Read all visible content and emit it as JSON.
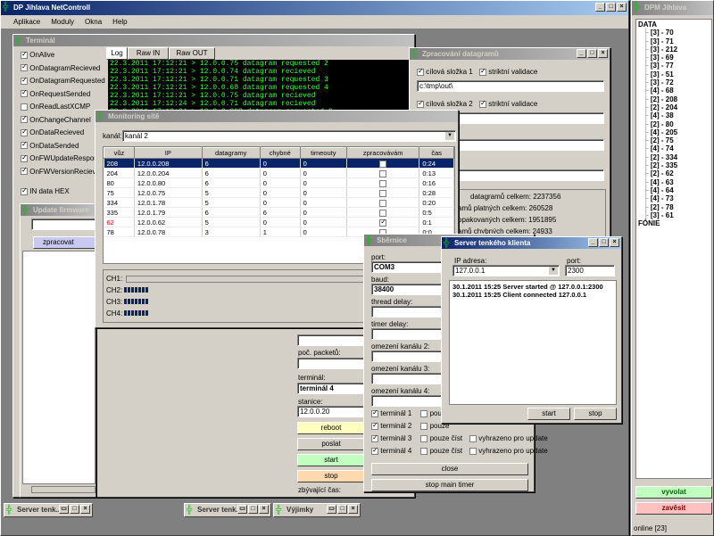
{
  "app": {
    "title": "DP Jihlava NetControll",
    "menu": [
      "Aplikace",
      "Moduly",
      "Okna",
      "Help"
    ]
  },
  "terminal": {
    "title": "Terminál",
    "checks": [
      {
        "label": "OnAlive",
        "on": true
      },
      {
        "label": "OnDatagramRecieved",
        "on": true
      },
      {
        "label": "OnDatagramRequested",
        "on": true
      },
      {
        "label": "OnRequestSended",
        "on": true
      },
      {
        "label": "OnReadLastXCMP",
        "on": false
      },
      {
        "label": "OnChangeChannel",
        "on": true
      },
      {
        "label": "OnDataRecieved",
        "on": true
      },
      {
        "label": "OnDataSended",
        "on": true
      },
      {
        "label": "OnFWUpdateResponse",
        "on": true
      },
      {
        "label": "OnFWVersionRecieved",
        "on": true
      }
    ],
    "in_data_hex": "IN data HEX",
    "tabs": [
      "Log",
      "Raw IN data",
      "Raw OUT data"
    ],
    "log": [
      "22.3.2011 17:12:21 > 12.0.0.75 datagram requested 2",
      "22.3.2011 17:12:21 > 12.0.0.74 datagram recieved",
      "22.3.2011 17:12:21 > 12.0.0.71 datagram requested 3",
      "22.3.2011 17:12:21 > 12.0.0.68 datagram requested 4",
      "22.3.2011 17:12:21 > 12.0.0.75 datagram recieved",
      "22.3.2011 17:12:24 > 12.0.0.71 datagram recieved",
      "22.3.2011 17:12:24 > 12.0.0.208 datagram requested 2",
      "22.3.2011 17:12:25 > 12.0.0.68 datagram recieved"
    ],
    "poc_packetu": "poč. packetů:",
    "terminal_label": "terminál:",
    "terminal_value": "terminál 4",
    "stanice_label": "stanice:",
    "stanice_value": "12.0.0.20",
    "reboot": "reboot",
    "poslat": "poslat",
    "start": "start",
    "stop": "stop",
    "zbyvajici": "zbývající čas:"
  },
  "update_fw": {
    "title": "Update firmware",
    "zpracovat": "zpracovat"
  },
  "zpracovani": {
    "title": "Zpracování datagramů",
    "cilova1": "cílová složka 1",
    "striktni1": "striktní validace",
    "path1": "c:\\tmp\\out\\",
    "cilova2": "cílová složka 2",
    "striktni2": "striktní validace",
    "stats": [
      "datagramů celkem: 2237356",
      "amů platných celkem: 260528",
      "opakovaných celkem: 1951895",
      "amů chybných celkem: 24933"
    ]
  },
  "monitoring": {
    "title": "Monitoring sítě",
    "kanal_label": "kanál:",
    "kanal_value": "kanál 2",
    "columns": [
      "vůz",
      "IP",
      "datagramy",
      "chybné",
      "timeouty",
      "zpracovávám",
      "čas"
    ],
    "rows": [
      {
        "vuz": "208",
        "ip": "12.0.0.208",
        "dg": "6",
        "ch": "0",
        "to": "0",
        "zp": false,
        "cas": "0:24",
        "sel": true
      },
      {
        "vuz": "204",
        "ip": "12.0.0.204",
        "dg": "6",
        "ch": "0",
        "to": "0",
        "zp": false,
        "cas": "0:13"
      },
      {
        "vuz": "80",
        "ip": "12.0.0.80",
        "dg": "6",
        "ch": "0",
        "to": "0",
        "zp": false,
        "cas": "0:16"
      },
      {
        "vuz": "75",
        "ip": "12.0.0.75",
        "dg": "5",
        "ch": "0",
        "to": "0",
        "zp": false,
        "cas": "0:28"
      },
      {
        "vuz": "334",
        "ip": "12.0.1.78",
        "dg": "5",
        "ch": "0",
        "to": "0",
        "zp": false,
        "cas": "0:20"
      },
      {
        "vuz": "335",
        "ip": "12.0.1.79",
        "dg": "6",
        "ch": "6",
        "to": "0",
        "zp": false,
        "cas": "0:5"
      },
      {
        "vuz": "62",
        "ip": "12.0.0.62",
        "dg": "5",
        "ch": "0",
        "to": "0",
        "zp": true,
        "cas": "0:1",
        "red": true
      },
      {
        "vuz": "78",
        "ip": "12.0.0.78",
        "dg": "3",
        "ch": "1",
        "to": "0",
        "zp": false,
        "cas": "0:0"
      }
    ],
    "channels": [
      {
        "name": "CH1:",
        "bars": 0
      },
      {
        "name": "CH2:",
        "bars": 7
      },
      {
        "name": "CH3:",
        "bars": 7
      },
      {
        "name": "CH4:",
        "bars": 7
      }
    ]
  },
  "sbernice": {
    "title": "Sběrnice",
    "port_label": "port:",
    "port_value": "COM3",
    "baud_label": "baud:",
    "baud_value": "38400",
    "thread_delay": "thread delay:",
    "timer_delay": "timer delay:",
    "omez2": "omezení kanálu 2:",
    "omez3": "omezení kanálu 3:",
    "omez4": "omezení kanálu 4:",
    "terms": [
      {
        "t": "terminál 1",
        "p": "pouze"
      },
      {
        "t": "terminál 2",
        "p": "pouze"
      },
      {
        "t": "terminál 3",
        "p": "pouze číst",
        "v": "vyhrazeno pro update"
      },
      {
        "t": "terminál 4",
        "p": "pouze číst",
        "v": "vyhrazeno pro update"
      }
    ],
    "close": "close",
    "stop_main": "stop main timer"
  },
  "server": {
    "title": "Server tenkého klienta",
    "ip_label": "IP adresa:",
    "ip_value": "127.0.0.1",
    "port_label": "port:",
    "port_value": "2300",
    "log": [
      "30.1.2011 15:25 Server started @ 127.0.0.1:2300",
      "30.1.2011 15:25 Client connected 127.0.0.1"
    ],
    "start": "start",
    "stop": "stop"
  },
  "dpm": {
    "title": "DPM Jihlava",
    "root": "DATA",
    "items": [
      "[3] - 70",
      "[3] - 71",
      "[3] - 212",
      "[3] - 69",
      "[3] - 77",
      "[3] - 51",
      "[3] - 72",
      "[4] - 68",
      "[2] - 208",
      "[2] - 204",
      "[4] - 38",
      "[2] - 80",
      "[4] - 205",
      "[2] - 75",
      "[4] - 74",
      "[2] - 334",
      "[2] - 335",
      "[2] - 62",
      "[4] - 63",
      "[4] - 64",
      "[4] - 73",
      "[2] - 78",
      "[3] - 61"
    ],
    "fonie": "FÓNIE",
    "vyvolat": "vyvolat",
    "zavesit": "zavěsit",
    "online": "online [23]"
  },
  "tasks": [
    "Server tenk...",
    "Server tenk...",
    "Výjimky"
  ]
}
